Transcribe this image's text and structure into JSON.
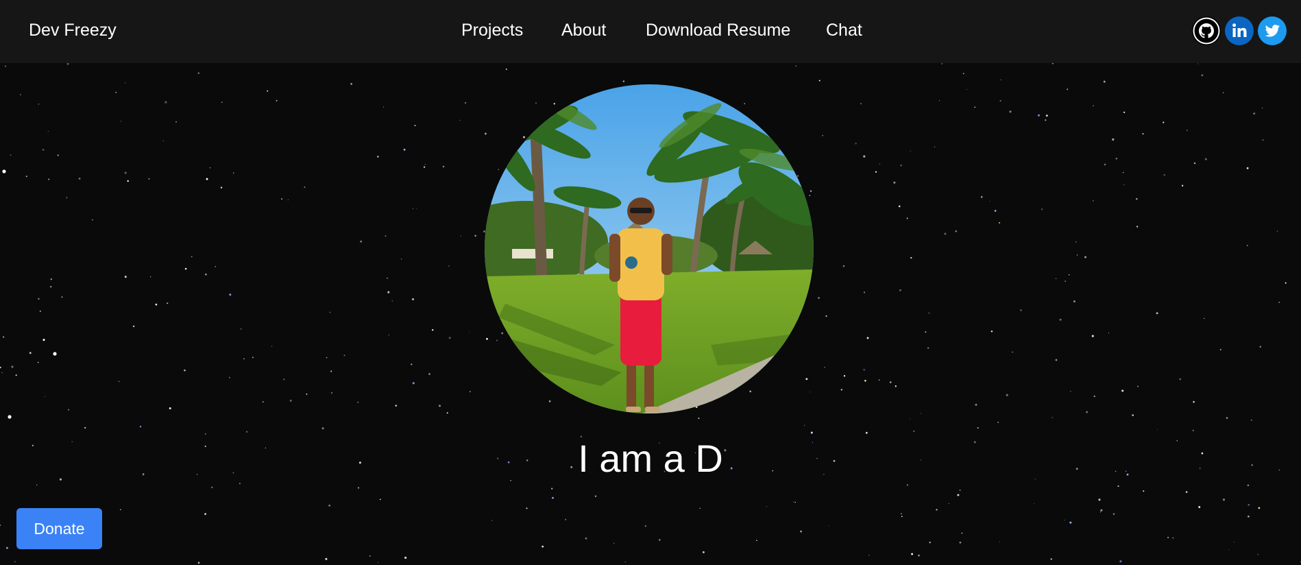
{
  "brand": "Dev Freezy",
  "nav": {
    "projects": "Projects",
    "about": "About",
    "resume": "Download Resume",
    "chat": "Chat"
  },
  "social": [
    "github-icon",
    "linkedin-icon",
    "twitter-icon"
  ],
  "hero": {
    "tagline": "I am a D",
    "photo": "profile-photo"
  },
  "donate": "Donate",
  "colors": {
    "navbar_bg": "#161616",
    "page_bg": "#0a0a0a",
    "donate_bg": "#3b82f6",
    "linkedin": "#0a66c2",
    "twitter": "#1d9bf0"
  }
}
